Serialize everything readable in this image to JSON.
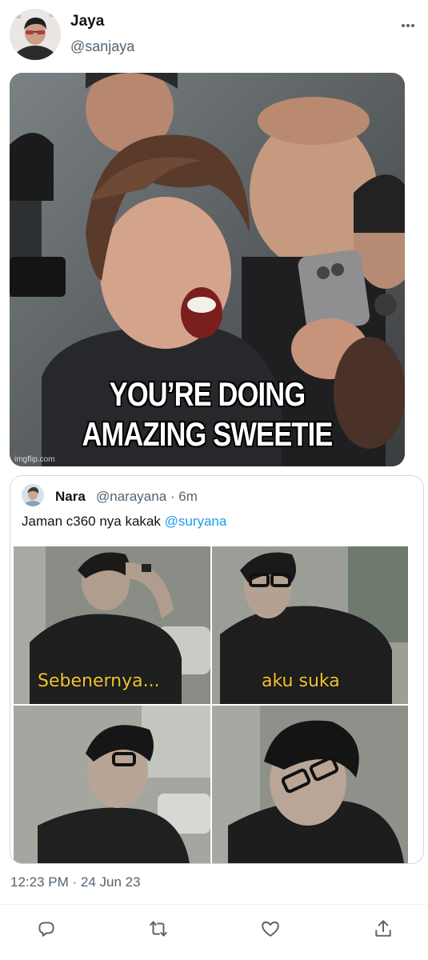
{
  "author": {
    "name": "Jaya",
    "handle": "@sanjaya"
  },
  "icons": {
    "more": "more-icon",
    "reply": "reply-icon",
    "retweet": "retweet-icon",
    "like": "heart-icon",
    "share": "share-icon"
  },
  "meme": {
    "caption_line1": "YOU’RE DOING",
    "caption_line2": "AMAZING SWEETIE",
    "watermark": "imgflip.com"
  },
  "quoted_tweet": {
    "name": "Nara",
    "handle_time": "@narayana · 6m",
    "text": "Jaman c360 nya kakak ",
    "mention": "@suryana",
    "collage_labels": [
      "Sebenernya...",
      "aku suka"
    ]
  },
  "timestamp": "12:23 PM · 24 Jun 23",
  "colors": {
    "accent": "#1d9bf0",
    "secondary_text": "#536471",
    "border": "#cfd9de",
    "caption_yellow": "#f2c12e"
  }
}
